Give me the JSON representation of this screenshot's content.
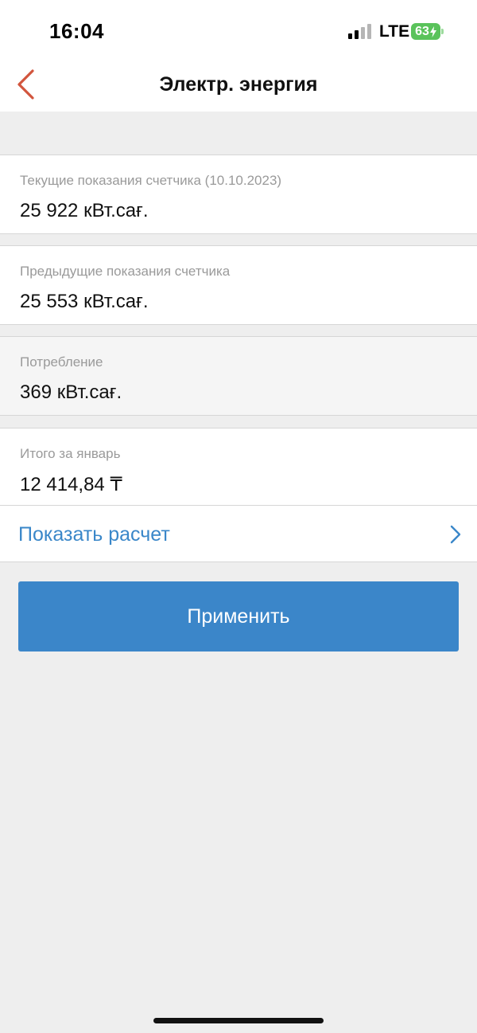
{
  "status_bar": {
    "time": "16:04",
    "network": "LTE",
    "battery": "63"
  },
  "header": {
    "title": "Электр. энергия",
    "back_icon": "chevron-left-icon"
  },
  "fields": {
    "current": {
      "label": "Текущие показания счетчика (10.10.2023)",
      "value": "25 922 кВт.сағ."
    },
    "previous": {
      "label": "Предыдущие показания счетчика",
      "value": "25 553 кВт.сағ."
    },
    "consumption": {
      "label": "Потребление",
      "value": "369 кВт.сағ."
    },
    "total": {
      "label": "Итого за январь",
      "value": "12 414,84 ₸"
    }
  },
  "show_calculation": {
    "label": "Показать расчет",
    "icon": "chevron-right-icon"
  },
  "apply_button": {
    "label": "Применить"
  },
  "colors": {
    "accent": "#3b86c9",
    "back_arrow": "#d2553d",
    "battery": "#5ac35b",
    "background": "#eeeeee"
  }
}
